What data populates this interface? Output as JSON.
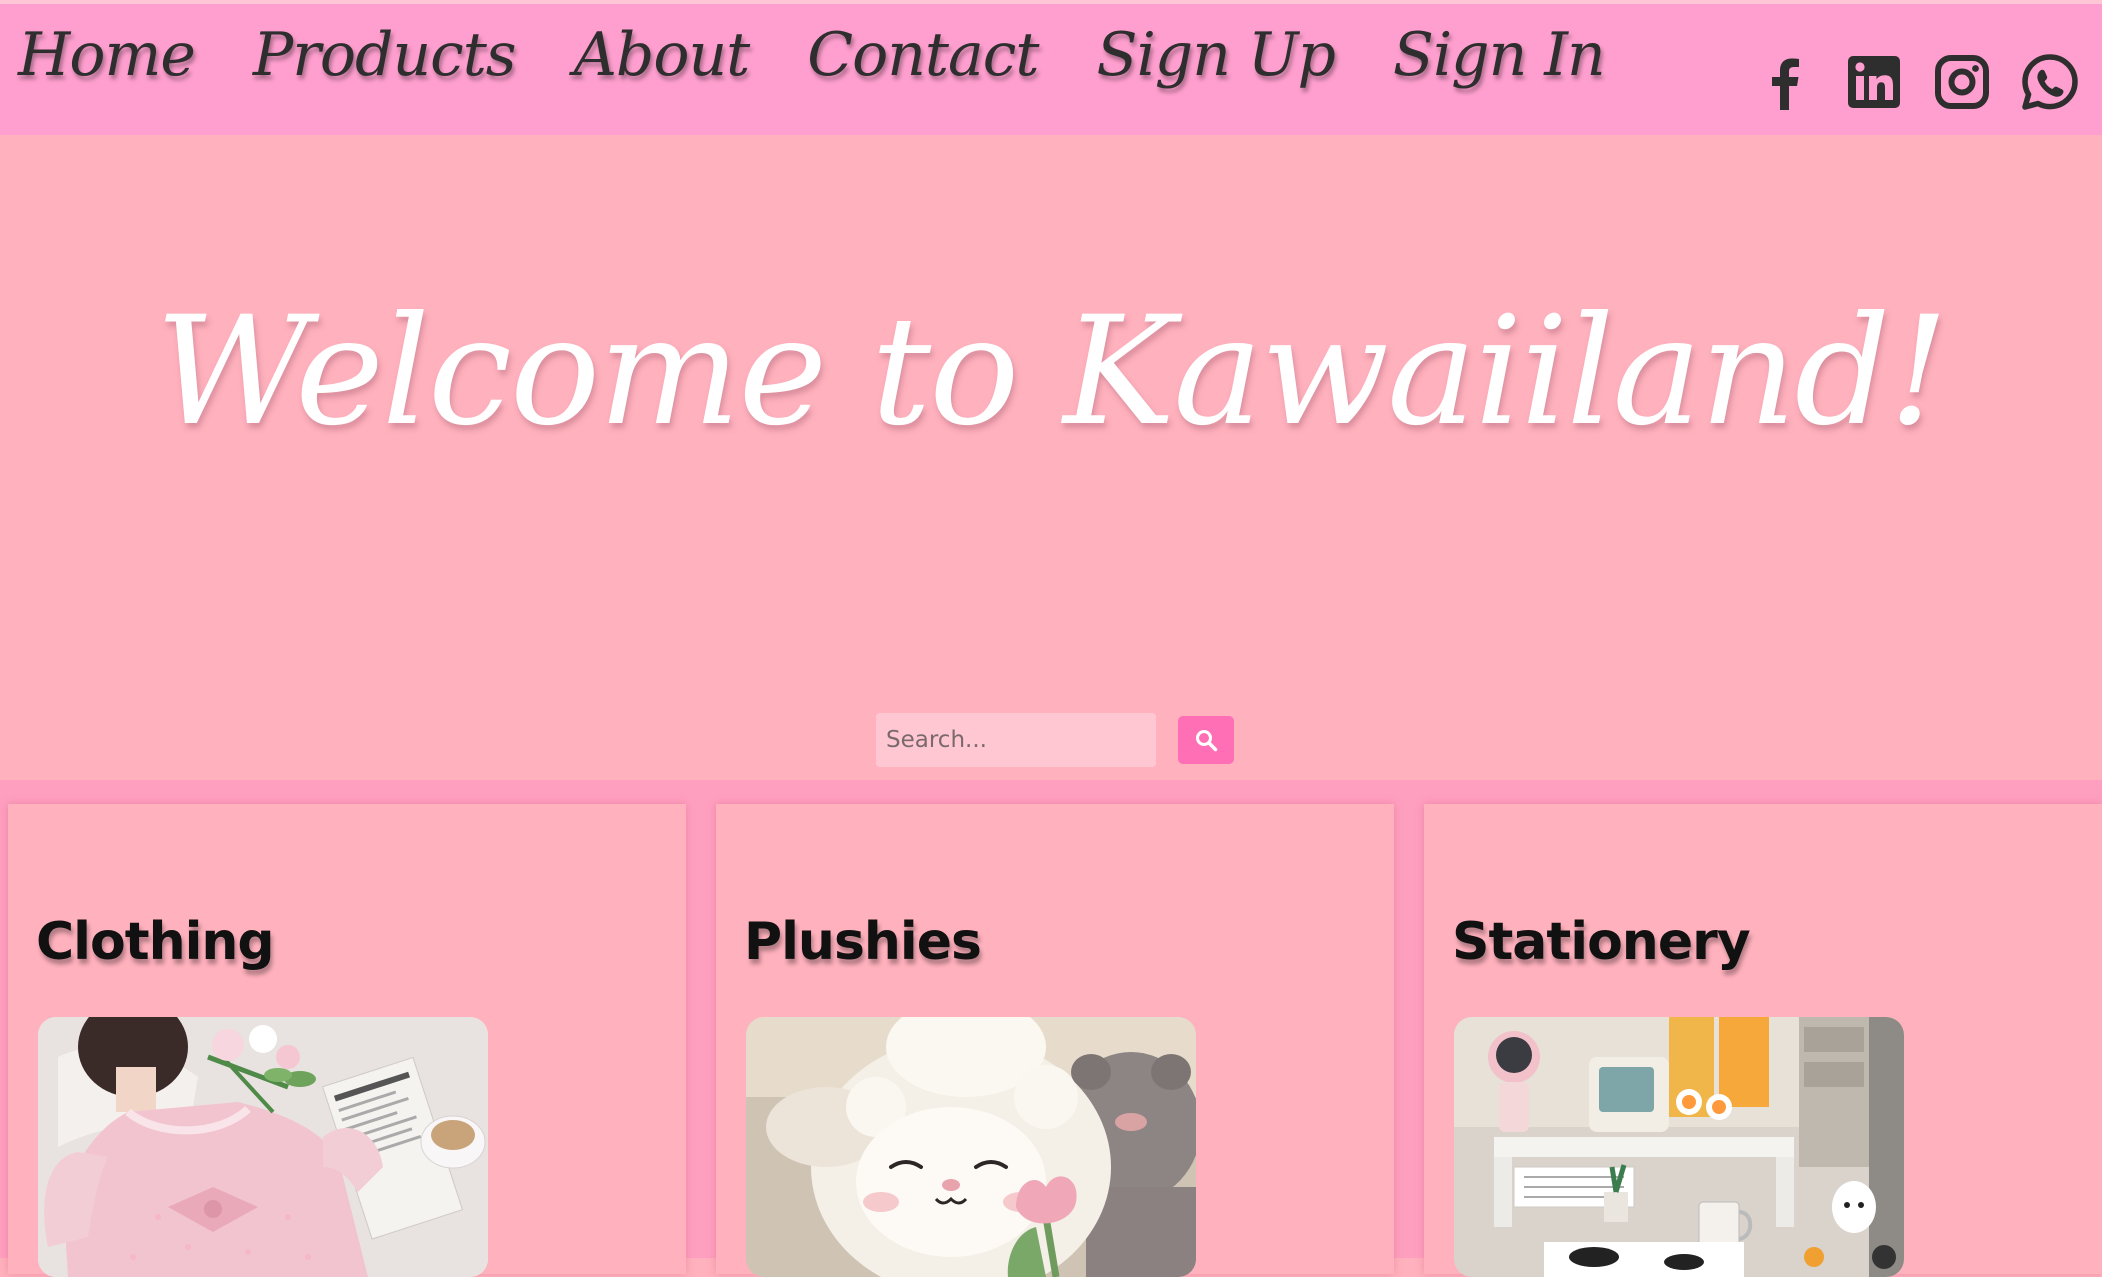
{
  "nav": {
    "links": [
      "Home",
      "Products",
      "About",
      "Contact",
      "Sign Up",
      "Sign In"
    ],
    "social_icons": [
      "facebook-icon",
      "linkedin-icon",
      "instagram-icon",
      "whatsapp-icon"
    ]
  },
  "hero": {
    "title": "Welcome to Kawaiiland!"
  },
  "search": {
    "placeholder": "Search...",
    "button_icon": "search-icon"
  },
  "categories": [
    {
      "title": "Clothing",
      "image": "pink-dress-photo"
    },
    {
      "title": "Plushies",
      "image": "lamb-plush-photo"
    },
    {
      "title": "Stationery",
      "image": "desk-stationery-photo"
    }
  ],
  "colors": {
    "navbar": "#ff9fcf",
    "background": "#ffb1bd",
    "search_button": "#ff6fb5",
    "nav_text": "#2e2e2e",
    "hero_text": "#ffffff"
  }
}
